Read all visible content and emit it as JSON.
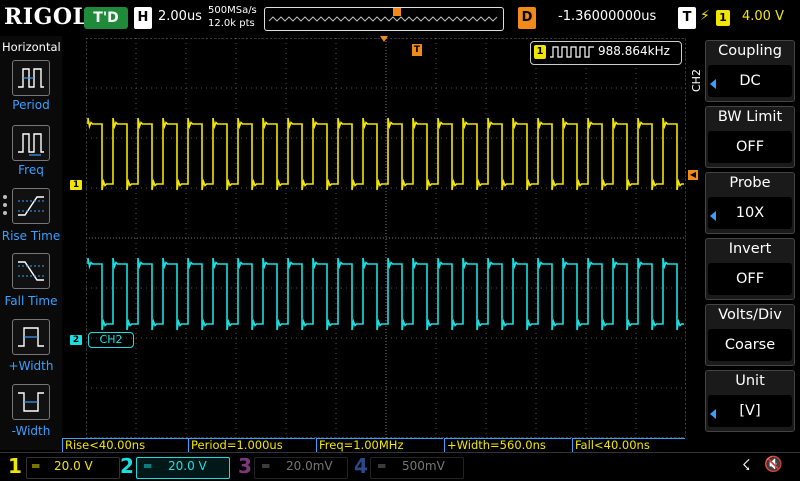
{
  "topbar": {
    "brand": "RIGOL",
    "trigger_status": "T'D",
    "timebase_letter": "H",
    "timebase_value": "2.00us",
    "sample_rate": "500MSa/s",
    "memory_depth": "12.0k pts",
    "delay_letter": "D",
    "delay_value": "-1.36000000us",
    "trigger_letter": "T",
    "trigger_edge_icon": "rising-edge-icon",
    "trigger_source": "1",
    "trigger_level": "4.00 V"
  },
  "left_menu": {
    "title": "Horizontal",
    "items": [
      {
        "label": "Period",
        "icon": "period-icon"
      },
      {
        "label": "Freq",
        "icon": "frequency-icon"
      },
      {
        "label": "Rise Time",
        "icon": "rise-time-icon"
      },
      {
        "label": "Fall Time",
        "icon": "fall-time-icon"
      },
      {
        "label": "+Width",
        "icon": "positive-width-icon"
      },
      {
        "label": "-Width",
        "icon": "negative-width-icon"
      }
    ]
  },
  "screen": {
    "freq_counter_channel": "1",
    "freq_counter_value": "988.864kHz",
    "ch1_marker": "1",
    "ch2_marker": "2",
    "ch2_label": "CH2",
    "trigger_marker": "T",
    "colors": {
      "ch1": "#f2e600",
      "ch2": "#19e0e0",
      "ch3": "#c050c0",
      "ch4": "#3a6ad0",
      "trigger": "#f08a1a"
    }
  },
  "right_menu": {
    "channel": "CH2",
    "items": [
      {
        "title": "Coupling",
        "value": "DC"
      },
      {
        "title": "BW Limit",
        "value": "OFF"
      },
      {
        "title": "Probe",
        "value": "10X"
      },
      {
        "title": "Invert",
        "value": "OFF"
      },
      {
        "title": "Volts/Div",
        "value": "Coarse"
      },
      {
        "title": "Unit",
        "value": "[V]"
      }
    ]
  },
  "measurements": [
    {
      "text": "Rise<40.00ns"
    },
    {
      "text": "Period=1.000us"
    },
    {
      "text": "Freq=1.00MHz"
    },
    {
      "text": "+Width=560.0ns"
    },
    {
      "text": "Fall<40.00ns"
    }
  ],
  "channels": [
    {
      "number": "1",
      "scale": "20.0 V"
    },
    {
      "number": "2",
      "scale": "20.0 V"
    },
    {
      "number": "3",
      "scale": "20.0mV"
    },
    {
      "number": "4",
      "scale": "500mV"
    }
  ],
  "status_icons": [
    "usb-icon",
    "speaker-mute-icon"
  ]
}
